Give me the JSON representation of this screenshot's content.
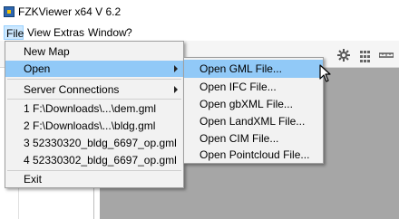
{
  "window": {
    "title": "FZKViewer x64 V 6.2"
  },
  "menubar": {
    "file": "File",
    "view": "View",
    "extras": "Extras",
    "window": "Window",
    "help": "?"
  },
  "file_menu": {
    "items": [
      {
        "label": "New Map"
      },
      {
        "label": "Open",
        "submenu": true,
        "highlighted": true
      },
      {
        "label": "Server Connections",
        "submenu": true
      },
      {
        "label": "1 F:\\Downloads\\...\\dem.gml"
      },
      {
        "label": "2 F:\\Downloads\\...\\bldg.gml"
      },
      {
        "label": "3 52330320_bldg_6697_op.gml"
      },
      {
        "label": "4 52330302_bldg_6697_op.gml"
      },
      {
        "label": "Exit"
      }
    ]
  },
  "open_submenu": {
    "items": [
      {
        "label": "Open GML File...",
        "highlighted": true
      },
      {
        "label": "Open IFC File..."
      },
      {
        "label": "Open gbXML File..."
      },
      {
        "label": "Open LandXML File..."
      },
      {
        "label": "Open CIM File..."
      },
      {
        "label": "Open Pointcloud File..."
      }
    ]
  },
  "toolbar": {
    "icons": [
      "gear-icon",
      "grid-icon",
      "ruler-icon"
    ]
  },
  "colors": {
    "highlight": "#91c9f7",
    "menu_bg": "#f2f2f2",
    "viewport": "#a6a6a6"
  }
}
